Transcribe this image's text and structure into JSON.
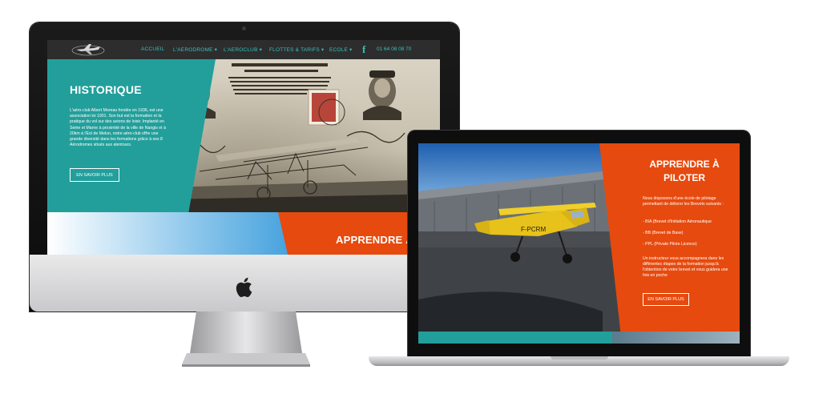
{
  "imac": {
    "nav": {
      "items": [
        {
          "label": "ACCUEIL"
        },
        {
          "label": "L'AERODROME ▾"
        },
        {
          "label": "L'AEROCLUB ▾"
        },
        {
          "label": "FLOTTES & TARIFS ▾"
        },
        {
          "label": "ECOLE ▾"
        }
      ],
      "facebook_label": "f",
      "phone": "01 64 08 08 70"
    },
    "hero": {
      "title": "HISTORIQUE",
      "text": "L'aéro-club Albert Moreau fondée en 1936, est une association loi 1901. Son but est la formation et la pratique du vol sur des avions de loisir. Implanté en Seine et Marne à proximité de la ville de Nangis et à 20km à l'Est de Melun, notre aéro-club offre une grande diversité dans les formations grâce à ses 8 Aérodromes situés aux alentours.",
      "button": "EN SAVOIR PLUS"
    },
    "lower_title": "APPRENDRE À"
  },
  "macbook": {
    "title_line1": "APPRENDRE À",
    "title_line2": "PILOTER",
    "intro": "Nous disposons d'une école de pilotage permettant de délivrer les Brevets suivants :",
    "items": [
      "- BIA (Brevet d'Initiation Aéronautique",
      "- BB (Brevet de Base)",
      "- PPL (Private Pilote Licence)"
    ],
    "outro": "Un instructeur vous accompagnera dans les différentes étapes de la formation jusqu'à l'obtention de votre brevet et vous guidera une fois en poche",
    "button": "EN SAVOIR PLUS"
  },
  "colors": {
    "teal": "#229f9b",
    "nav_text": "#34c1bd",
    "orange": "#e64a0e",
    "nav_bg": "#2d2d2d"
  }
}
